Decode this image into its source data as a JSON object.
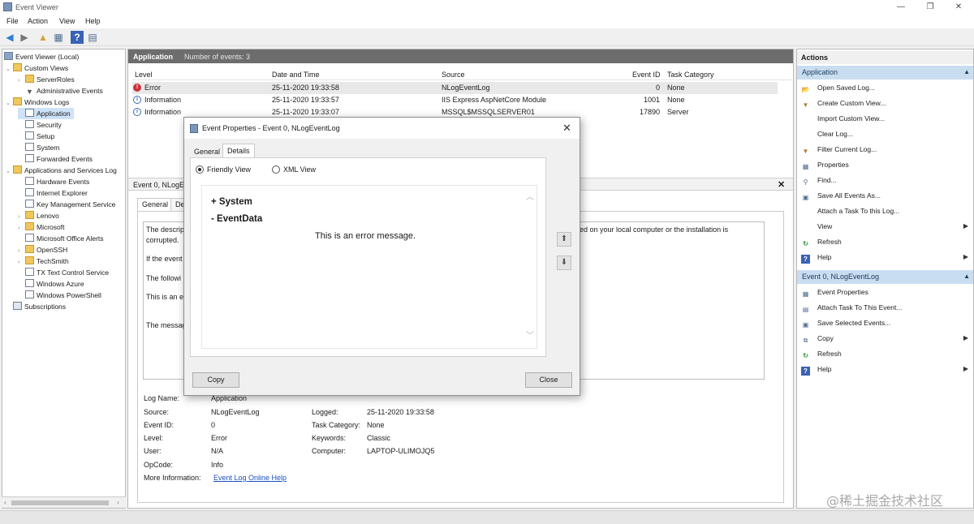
{
  "window": {
    "title": "Event Viewer"
  },
  "window_controls": {
    "minimize": "—",
    "maximize": "❐",
    "close": "✕"
  },
  "menu": [
    "File",
    "Action",
    "View",
    "Help"
  ],
  "toolbar": {
    "back": "◀",
    "forward": "▶",
    "up": "▲",
    "props": "▦",
    "help": "?",
    "show": "▤"
  },
  "tree": {
    "items": [
      {
        "label": "Event Viewer (Local)",
        "twist": "",
        "icon": "event-viewer-icon"
      },
      {
        "label": "Custom Views",
        "twist": "⌄",
        "icon": "folder-icon"
      },
      {
        "label": "ServerRoles",
        "twist": "›",
        "icon": "folder-icon"
      },
      {
        "label": "Administrative Events",
        "twist": "",
        "icon": "filter-icon"
      },
      {
        "label": "Windows Logs",
        "twist": "⌄",
        "icon": "folder-icon"
      },
      {
        "label": "Application",
        "twist": "",
        "icon": "log-icon"
      },
      {
        "label": "Security",
        "twist": "",
        "icon": "log-icon"
      },
      {
        "label": "Setup",
        "twist": "",
        "icon": "log-icon"
      },
      {
        "label": "System",
        "twist": "",
        "icon": "log-icon"
      },
      {
        "label": "Forwarded Events",
        "twist": "",
        "icon": "log-icon"
      },
      {
        "label": "Applications and Services Log",
        "twist": "⌄",
        "icon": "folder-icon"
      },
      {
        "label": "Hardware Events",
        "twist": "",
        "icon": "log-icon"
      },
      {
        "label": "Internet Explorer",
        "twist": "",
        "icon": "log-icon"
      },
      {
        "label": "Key Management Service",
        "twist": "",
        "icon": "log-icon"
      },
      {
        "label": "Lenovo",
        "twist": "›",
        "icon": "folder-icon"
      },
      {
        "label": "Microsoft",
        "twist": "›",
        "icon": "folder-icon"
      },
      {
        "label": "Microsoft Office Alerts",
        "twist": "",
        "icon": "log-icon"
      },
      {
        "label": "OpenSSH",
        "twist": "›",
        "icon": "folder-icon"
      },
      {
        "label": "TechSmith",
        "twist": "›",
        "icon": "folder-icon"
      },
      {
        "label": "TX Text Control Service",
        "twist": "",
        "icon": "log-icon"
      },
      {
        "label": "Windows Azure",
        "twist": "",
        "icon": "log-icon"
      },
      {
        "label": "Windows PowerShell",
        "twist": "",
        "icon": "log-icon"
      },
      {
        "label": "Subscriptions",
        "twist": "",
        "icon": "subscriptions-icon"
      }
    ]
  },
  "center": {
    "title": "Application",
    "count": "Number of events: 3",
    "columns": [
      "Level",
      "Date and Time",
      "Source",
      "Event ID",
      "Task Category"
    ],
    "events": [
      {
        "level": "Error",
        "date": "25-11-2020 19:33:58",
        "source": "NLogEventLog",
        "id": "0",
        "category": "None",
        "icon": "!"
      },
      {
        "level": "Information",
        "date": "25-11-2020 19:33:57",
        "source": "IIS Express AspNetCore Module",
        "id": "1001",
        "category": "None",
        "icon": "i"
      },
      {
        "level": "Information",
        "date": "25-11-2020 19:33:07",
        "source": "MSSQL$MSSQLSERVER01",
        "id": "17890",
        "category": "Server",
        "icon": "i"
      }
    ]
  },
  "detail": {
    "header": "Event 0, NLogEventLog",
    "close": "✕",
    "tab_general": "General",
    "tab_details": "Det",
    "desc_lines": [
      "The descrip",
      "corrupted.",
      "If the event",
      "The followi",
      "This is an e",
      "The messag"
    ],
    "desc_tail": "lled on your local computer or the installation is",
    "props_left": [
      {
        "label": "Log Name:",
        "value": "Application"
      },
      {
        "label": "Source:",
        "value": "NLogEventLog"
      },
      {
        "label": "Event ID:",
        "value": "0"
      },
      {
        "label": "Level:",
        "value": "Error"
      },
      {
        "label": "User:",
        "value": "N/A"
      },
      {
        "label": "OpCode:",
        "value": "Info"
      },
      {
        "label": "More Information:",
        "value": "Event Log Online Help"
      }
    ],
    "props_right": [
      {
        "label": "Logged:",
        "value": "25-11-2020 19:33:58"
      },
      {
        "label": "Task Category:",
        "value": "None"
      },
      {
        "label": "Keywords:",
        "value": "Classic"
      },
      {
        "label": "Computer:",
        "value": "LAPTOP-ULIMOJQ5"
      }
    ]
  },
  "actions": {
    "title": "Actions",
    "section1": "Application",
    "section1_items": [
      {
        "label": "Open Saved Log...",
        "icon": "open-log-icon",
        "glyph": "📂",
        "sub": false
      },
      {
        "label": "Create Custom View...",
        "icon": "filter-icon",
        "glyph": "▼",
        "sub": false
      },
      {
        "label": "Import Custom View...",
        "icon": "",
        "glyph": "",
        "sub": false
      },
      {
        "label": "Clear Log...",
        "icon": "",
        "glyph": "",
        "sub": false
      },
      {
        "label": "Filter Current Log...",
        "icon": "filter-icon",
        "glyph": "▼",
        "sub": false
      },
      {
        "label": "Properties",
        "icon": "properties-icon",
        "glyph": "▦",
        "sub": false
      },
      {
        "label": "Find...",
        "icon": "find-icon",
        "glyph": "⚲",
        "sub": false
      },
      {
        "label": "Save All Events As...",
        "icon": "save-icon",
        "glyph": "▣",
        "sub": false
      },
      {
        "label": "Attach a Task To this Log...",
        "icon": "",
        "glyph": "",
        "sub": false
      },
      {
        "label": "View",
        "icon": "",
        "glyph": "",
        "sub": true
      },
      {
        "label": "Refresh",
        "icon": "refresh-icon",
        "glyph": "↻",
        "sub": false
      },
      {
        "label": "Help",
        "icon": "help-icon",
        "glyph": "?",
        "sub": true
      }
    ],
    "section2": "Event 0, NLogEventLog",
    "section2_items": [
      {
        "label": "Event Properties",
        "icon": "properties-icon",
        "glyph": "▦",
        "sub": false
      },
      {
        "label": "Attach Task To This Event...",
        "icon": "task-icon",
        "glyph": "▤",
        "sub": false
      },
      {
        "label": "Save Selected Events...",
        "icon": "save-icon",
        "glyph": "▣",
        "sub": false
      },
      {
        "label": "Copy",
        "icon": "copy-icon",
        "glyph": "⧉",
        "sub": true
      },
      {
        "label": "Refresh",
        "icon": "refresh-icon",
        "glyph": "↻",
        "sub": false
      },
      {
        "label": "Help",
        "icon": "help-icon",
        "glyph": "?",
        "sub": true
      }
    ],
    "collapse": "▲",
    "submenu_arrow": "▶"
  },
  "dialog": {
    "title": "Event Properties - Event 0, NLogEventLog",
    "close": "✕",
    "tab_general": "General",
    "tab_details": "Details",
    "radio_friendly": "Friendly View",
    "radio_xml": "XML View",
    "system_toggle": "+ System",
    "eventdata_toggle": "- EventData",
    "message": "This is an error message.",
    "up_btn": "⬆",
    "down_btn": "⬇",
    "copy_button": "Copy",
    "close_button": "Close",
    "scroll_up": "︿",
    "scroll_down": "﹀"
  },
  "watermark": "@稀土掘金技术社区",
  "colors": {
    "accent": "#c9ddf0",
    "header_gray": "#6d6d6d",
    "error_red": "#c9343b",
    "link_blue": "#1a4fc2"
  }
}
